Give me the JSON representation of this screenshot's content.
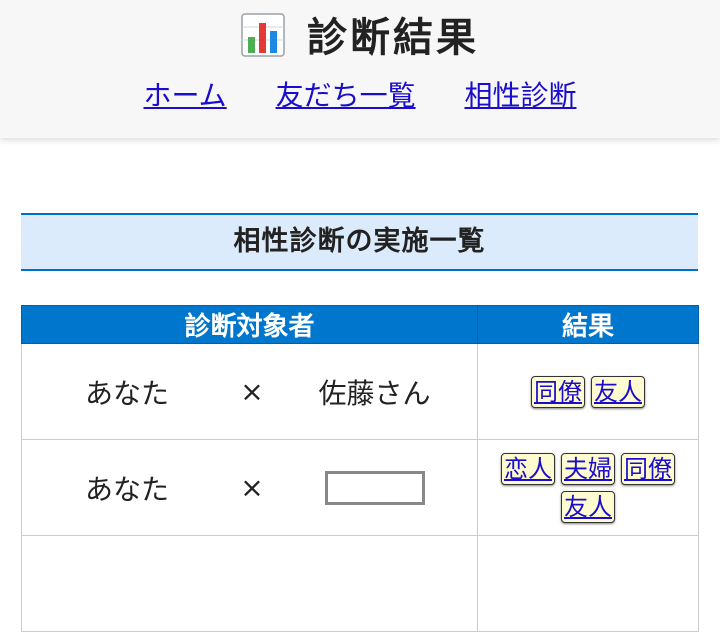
{
  "header": {
    "title": "診断結果",
    "title_icon": "bar-chart-icon",
    "nav": [
      "ホーム",
      "友だち一覧",
      "相性診断"
    ]
  },
  "section": {
    "heading": "相性診断の実施一覧"
  },
  "table": {
    "headers": [
      "診断対象者",
      "結果"
    ],
    "rows": [
      {
        "person1": "あなた",
        "separator": "×",
        "person2": "佐藤さん",
        "results": [
          "同僚",
          "友人"
        ]
      },
      {
        "person1": "あなた",
        "separator": "×",
        "person2": "",
        "results": [
          "恋人",
          "夫婦",
          "同僚",
          "友人"
        ]
      }
    ]
  },
  "colors": {
    "accent": "#0077cc",
    "heading_bg": "#dcebfb",
    "tag_bg": "#fffbd0",
    "link": "#1a0dcc"
  }
}
